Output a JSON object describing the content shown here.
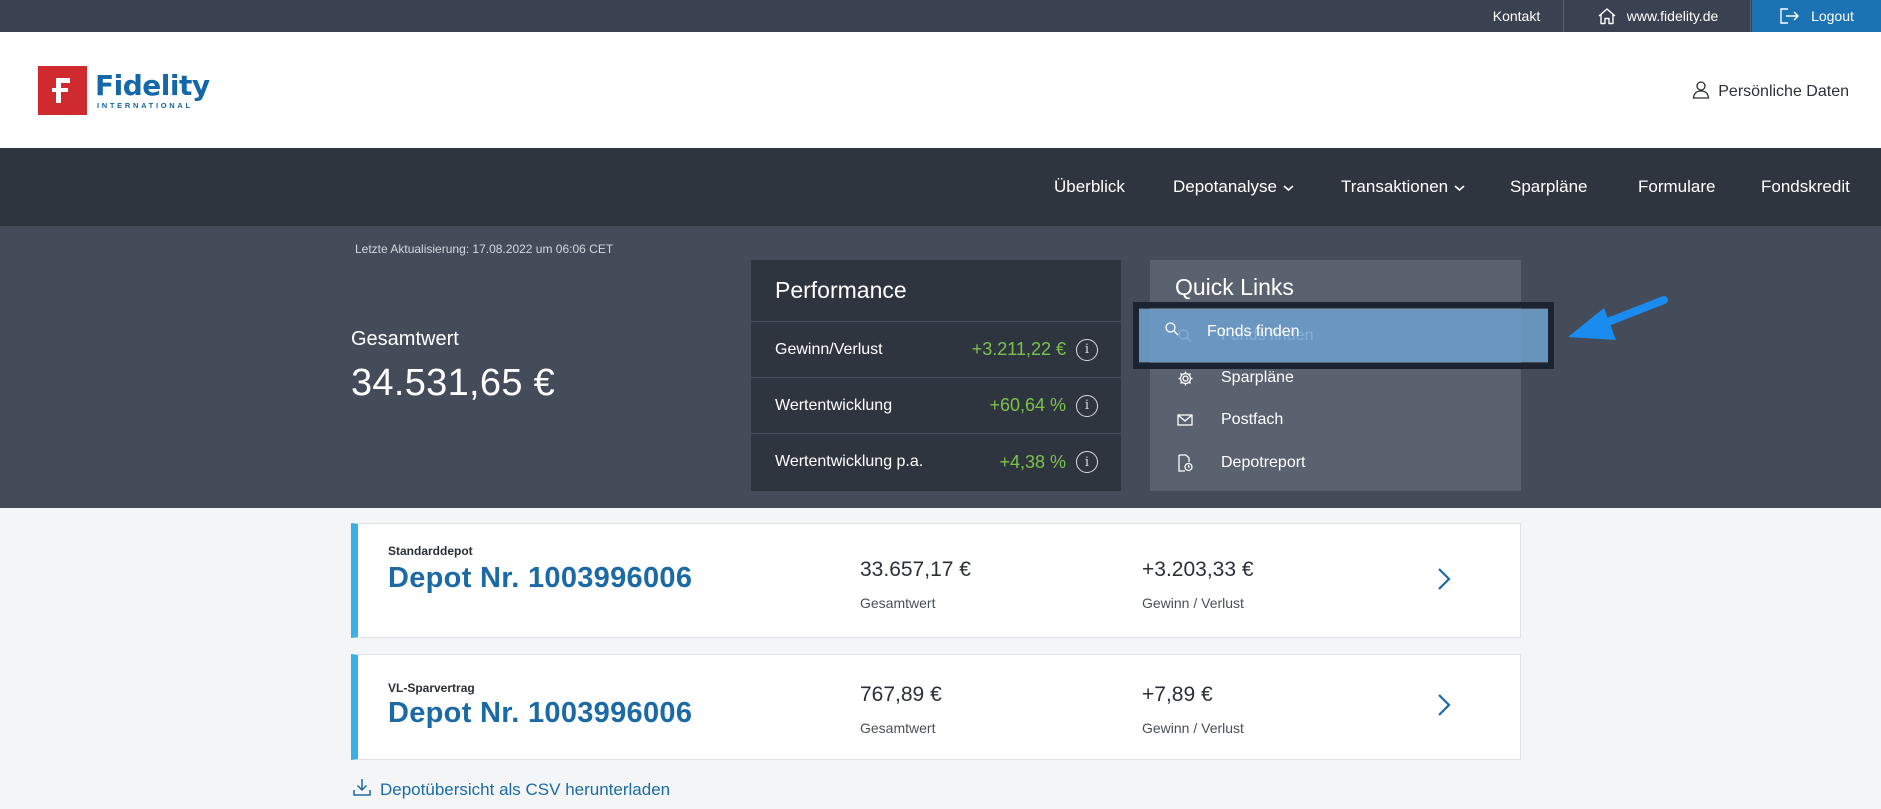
{
  "topbar": {
    "kontakt": "Kontakt",
    "site": "www.fidelity.de",
    "logout": "Logout"
  },
  "header": {
    "logo_word": "Fidelity",
    "logo_sub": "INTERNATIONAL",
    "personal": "Persönliche Daten"
  },
  "nav": {
    "ueberblick": "Überblick",
    "depotanalyse": "Depotanalyse",
    "transaktionen": "Transaktionen",
    "sparplaene": "Sparpläne",
    "formulare": "Formulare",
    "fondskredit": "Fondskredit"
  },
  "summary": {
    "last_update": "Letzte Aktualisierung: 17.08.2022 um 06:06 CET",
    "total_label": "Gesamtwert",
    "total_value": "34.531,65 €"
  },
  "performance": {
    "title": "Performance",
    "rows": [
      {
        "label": "Gewinn/Verlust",
        "value": "+3.211,22 €"
      },
      {
        "label": "Wertentwicklung",
        "value": "+60,64 %"
      },
      {
        "label": "Wertentwicklung p.a.",
        "value": "+4,38 %"
      }
    ]
  },
  "quick_links": {
    "title": "Quick Links",
    "items": [
      {
        "label": "Fonds finden",
        "icon": "search-icon"
      },
      {
        "label": "Sparpläne",
        "icon": "gear-icon"
      },
      {
        "label": "Postfach",
        "icon": "mail-icon"
      },
      {
        "label": "Depotreport",
        "icon": "report-icon"
      }
    ]
  },
  "depots": [
    {
      "type": "Standarddepot",
      "title": "Depot Nr. 1003996006",
      "total": "33.657,17 €",
      "total_label": "Gesamtwert",
      "gain": "+3.203,33 €",
      "gain_label": "Gewinn / Verlust"
    },
    {
      "type": "VL-Sparvertrag",
      "title": "Depot Nr. 1003996006",
      "total": "767,89 €",
      "total_label": "Gesamtwert",
      "gain": "+7,89 €",
      "gain_label": "Gewinn / Verlust"
    }
  ],
  "csv_link": "Depotübersicht als CSV herunterladen",
  "colors": {
    "brand_blue": "#1b6aa5",
    "logo_red": "#cf2b2f",
    "positive_green": "#7cc14c",
    "card_accent": "#3ab1e6",
    "annotation_arrow": "#1a8cf0"
  }
}
